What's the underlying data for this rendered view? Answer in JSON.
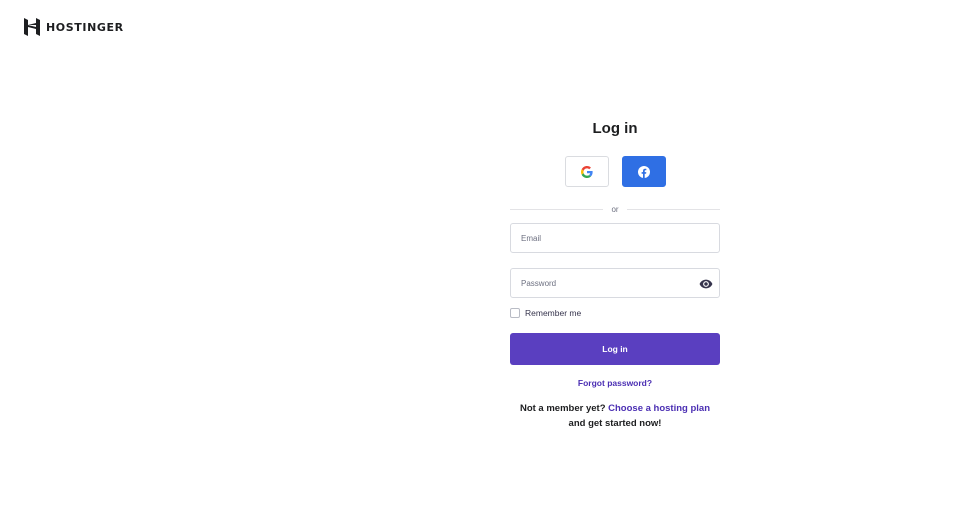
{
  "header": {
    "brand_name": "HOSTINGER",
    "logo_icon": "hostinger-logo-icon"
  },
  "login": {
    "title": "Log in",
    "social": [
      {
        "name": "google",
        "icon": "google-icon"
      },
      {
        "name": "facebook",
        "icon": "facebook-icon",
        "color": "#2f6fe4"
      }
    ],
    "divider_text": "or",
    "email": {
      "placeholder": "Email",
      "value": ""
    },
    "password": {
      "placeholder": "Password",
      "value": "",
      "toggle_icon": "eye-icon"
    },
    "remember_me": {
      "label": "Remember me",
      "checked": false
    },
    "submit_label": "Log in",
    "forgot_password": "Forgot password?",
    "signup": {
      "prefix": "Not a member yet?",
      "link": "Choose a hosting plan",
      "suffix": "and get started now!"
    }
  },
  "colors": {
    "primary": "#5a3fc0",
    "link": "#4b2fb3",
    "facebook": "#2f6fe4"
  }
}
